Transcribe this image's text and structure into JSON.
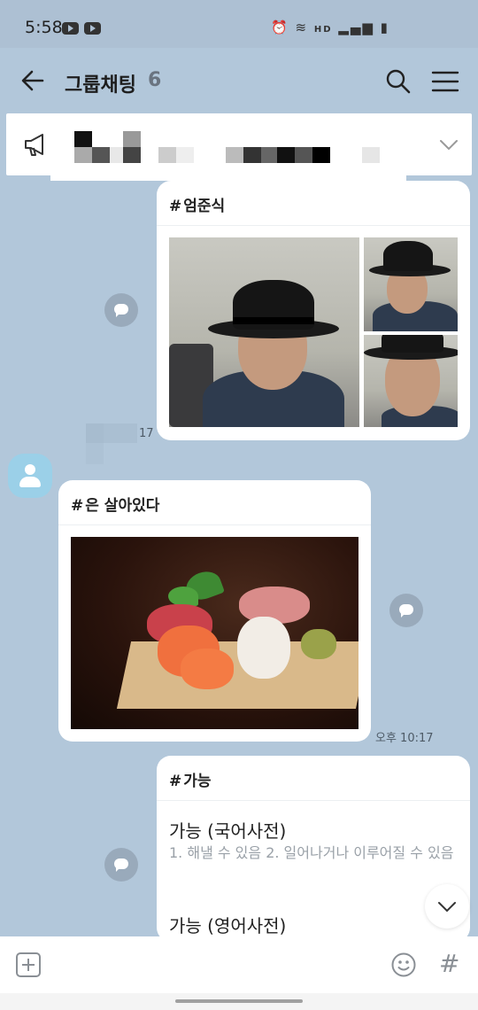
{
  "status_bar": {
    "time": "5:58",
    "hd_label": "HD"
  },
  "header": {
    "title": "그룹채팅",
    "member_count": "6"
  },
  "messages": [
    {
      "hashtag": "엄준식",
      "read_count": "17"
    },
    {
      "hashtag": "은 살아있다",
      "time": "오후 10:17"
    },
    {
      "hashtag": "가능",
      "entries": [
        {
          "title": "가능 (국어사전)",
          "definition": "1. 해낼 수 있음 2. 일어나거나 이루어질 수 있음"
        },
        {
          "title": "가능 (영어사전)"
        }
      ]
    }
  ],
  "input": {
    "placeholder": ""
  },
  "icons": [
    "back-arrow-icon",
    "search-icon",
    "menu-icon",
    "megaphone-icon",
    "chevron-down-icon",
    "share-icon",
    "plus-icon",
    "emoji-icon",
    "hashtag-icon"
  ],
  "colors": {
    "chat_background": "#b2c7da",
    "bubble": "#ffffff",
    "avatar": "#9bd0e8"
  }
}
